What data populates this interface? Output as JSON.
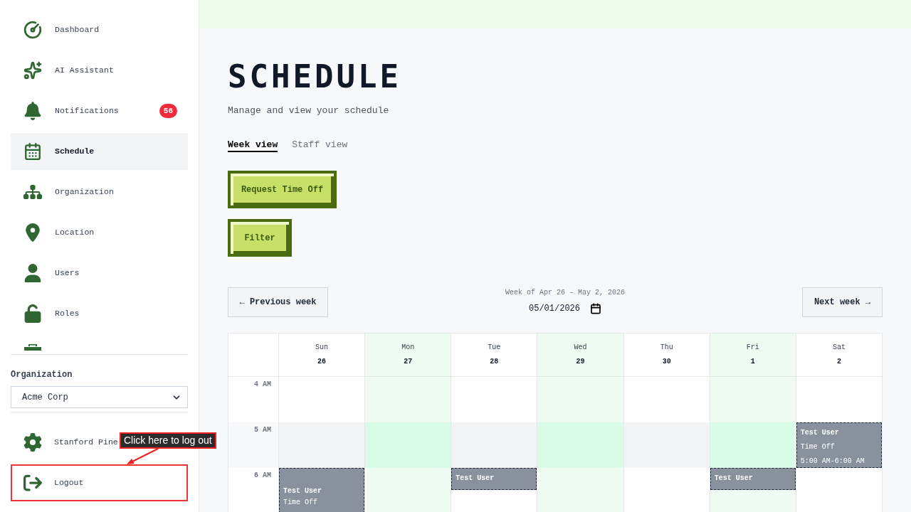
{
  "sidebar": {
    "nav_items": [
      {
        "label": "Dashboard",
        "selected": false
      },
      {
        "label": "AI Assistant",
        "selected": false
      },
      {
        "label": "Notifications",
        "selected": false,
        "badge": "56"
      },
      {
        "label": "Schedule",
        "selected": true
      },
      {
        "label": "Organization",
        "selected": false
      },
      {
        "label": "Location",
        "selected": false
      },
      {
        "label": "Users",
        "selected": false
      },
      {
        "label": "Roles",
        "selected": false
      }
    ],
    "organization": {
      "label": "Organization",
      "value": "Acme Corp"
    },
    "footer_items": [
      {
        "label": "Stanford Pine",
        "highlighted": false
      },
      {
        "label": "Logout",
        "highlighted": true
      }
    ]
  },
  "tooltip": {
    "text": "Click here to log out"
  },
  "page": {
    "title": "SCHEDULE",
    "subtitle": "Manage and view your schedule",
    "tabs": [
      {
        "label": "Week view",
        "selected": true
      },
      {
        "label": "Staff view",
        "selected": false
      }
    ],
    "actions": [
      "Request Time Off",
      "Filter"
    ]
  },
  "week_nav": {
    "previous": "← Previous week",
    "range": "Week of Apr 26 – May 2, 2026",
    "date": "05/01/2026",
    "next": "Next week →"
  },
  "calendar": {
    "days": [
      {
        "name": "Sun",
        "date": "26",
        "shaded": false
      },
      {
        "name": "Mon",
        "date": "27",
        "shaded": true
      },
      {
        "name": "Tue",
        "date": "28",
        "shaded": false
      },
      {
        "name": "Wed",
        "date": "29",
        "shaded": true
      },
      {
        "name": "Thu",
        "date": "30",
        "shaded": false
      },
      {
        "name": "Fri",
        "date": "1",
        "shaded": true
      },
      {
        "name": "Sat",
        "date": "2",
        "shaded": false
      }
    ],
    "rows": [
      {
        "time": "4 AM",
        "highlighted": false,
        "cells": [
          {
            "kind": "empty"
          },
          {
            "kind": "empty"
          },
          {
            "kind": "empty"
          },
          {
            "kind": "empty"
          },
          {
            "kind": "empty"
          },
          {
            "kind": "empty"
          },
          {
            "kind": "empty"
          }
        ]
      },
      {
        "time": "5 AM",
        "highlighted": true,
        "cells": [
          {
            "kind": "empty"
          },
          {
            "kind": "empty"
          },
          {
            "kind": "empty"
          },
          {
            "kind": "empty"
          },
          {
            "kind": "empty"
          },
          {
            "kind": "empty"
          },
          {
            "kind": "hour",
            "title": "Test User",
            "details": [
              "Time Off",
              "5:00 AM-6:00 AM"
            ]
          }
        ]
      },
      {
        "time": "6 AM",
        "highlighted": false,
        "cells": [
          {
            "kind": "long",
            "title": "Test User",
            "details": [
              "Time Off"
            ]
          },
          {
            "kind": "empty"
          },
          {
            "kind": "half",
            "title": "Test User"
          },
          {
            "kind": "empty"
          },
          {
            "kind": "empty"
          },
          {
            "kind": "half",
            "title": "Test User"
          },
          {
            "kind": "empty"
          }
        ]
      }
    ]
  }
}
